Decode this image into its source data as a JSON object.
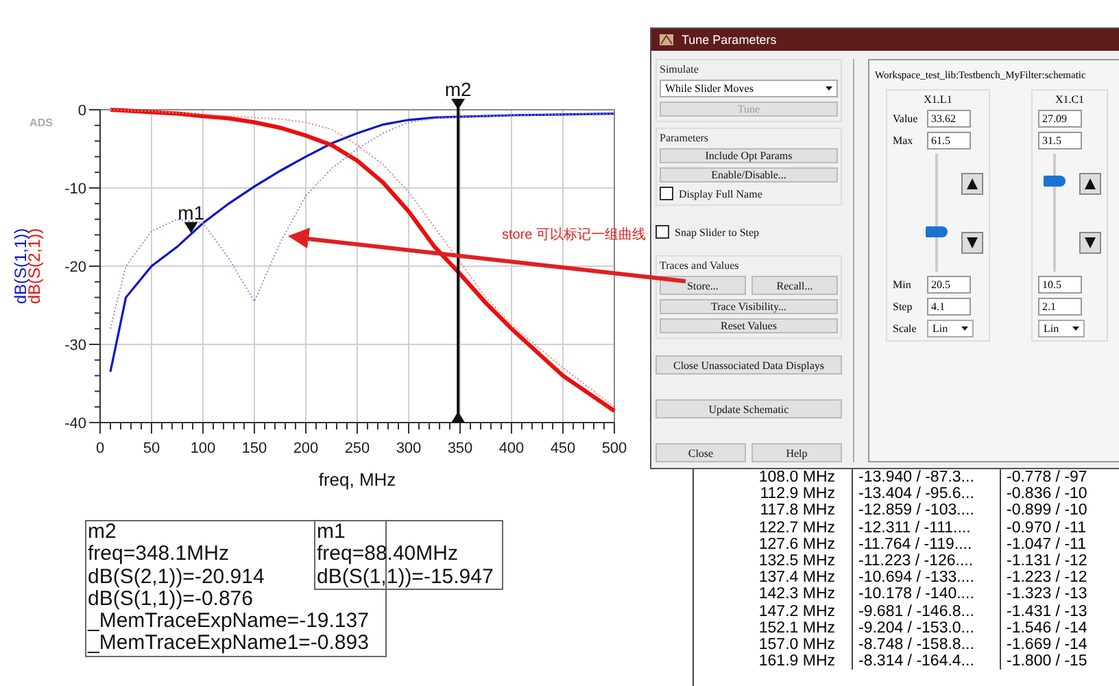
{
  "plot": {
    "logo": "ADS",
    "chart_data": {
      "type": "line",
      "xlabel": "freq, MHz",
      "x": [
        10,
        25,
        50,
        75,
        100,
        125,
        150,
        175,
        200,
        225,
        250,
        275,
        300,
        325,
        350,
        375,
        400,
        450,
        500
      ],
      "series": [
        {
          "name": "dB(S(1,1))",
          "color": "#0a14c8",
          "line_style": "solid",
          "values": [
            -33.5,
            -24,
            -20,
            -17.5,
            -14.5,
            -12,
            -9.8,
            -7.8,
            -6,
            -4.3,
            -3,
            -1.9,
            -1.3,
            -1.0,
            -0.9,
            -0.8,
            -0.7,
            -0.6,
            -0.5
          ]
        },
        {
          "name": "dB(S(2,1))",
          "color": "#e81010",
          "line_style": "solid",
          "values": [
            0,
            -0.1,
            -0.3,
            -0.5,
            -0.8,
            -1.1,
            -1.6,
            -2.3,
            -3.3,
            -4.5,
            -6.5,
            -9.3,
            -13,
            -17.5,
            -21,
            -24.7,
            -28,
            -34,
            -38.5
          ]
        },
        {
          "color": "#8c8ce6",
          "line_style": "dotted",
          "values": [
            -28,
            -20,
            -15.5,
            -14,
            -14.5,
            -19,
            -24.5,
            -17,
            -11,
            -7.5,
            -5,
            -3,
            -1.6,
            -1.1,
            -0.9,
            -0.8,
            -0.7,
            -0.6,
            -0.5
          ]
        },
        {
          "color": "#f08080",
          "line_style": "dotted",
          "values": [
            0,
            -0.1,
            -0.2,
            -0.4,
            -0.6,
            -0.8,
            -1,
            -1.2,
            -1.6,
            -2.5,
            -4.5,
            -7,
            -10.5,
            -15,
            -19.5,
            -24,
            -27.5,
            -33,
            -38
          ]
        }
      ],
      "grid": true,
      "xlim": [
        0,
        500
      ],
      "ylim": [
        -40,
        0
      ],
      "xticks": [
        0,
        50,
        100,
        150,
        200,
        250,
        300,
        350,
        400,
        450,
        500
      ],
      "yticks": [
        0,
        -10,
        -20,
        -30,
        -40
      ],
      "annotations": [
        {
          "text": "m1",
          "x": 88.4,
          "y": -15.947
        }
      ],
      "ref_lines": [
        {
          "axis": "x",
          "value": 348.1,
          "label": "m2",
          "color": "#111111"
        }
      ]
    }
  },
  "marker_readouts": [
    {
      "lines": [
        "m2",
        "freq=348.1MHz",
        "dB(S(2,1))=-20.914",
        "dB(S(1,1))=-0.876",
        "_MemTraceExpName=-19.137",
        "_MemTraceExpName1=-0.893"
      ]
    },
    {
      "lines": [
        "m1",
        "freq=88.40MHz",
        "dB(S(1,1))=-15.947"
      ]
    }
  ],
  "callout": {
    "text": "store 可以标记一组曲线"
  },
  "dialog": {
    "title": "Tune Parameters",
    "simulate": {
      "label": "Simulate",
      "mode": "While Slider Moves",
      "tune": {
        "label": "Tune",
        "disabled": true
      }
    },
    "parameters": {
      "label": "Parameters",
      "buttons": [
        "Include Opt Params",
        "Enable/Disable..."
      ],
      "display_full_name": {
        "label": "Display Full Name",
        "checked": false
      }
    },
    "snap": {
      "label": "Snap Slider to Step",
      "checked": false
    },
    "traces": {
      "label": "Traces and Values",
      "store": "Store...",
      "recall": "Recall...",
      "buttons": [
        "Trace Visibility...",
        "Reset Values"
      ]
    },
    "close_unassociated": "Close Unassociated Data Displays",
    "update": "Update Schematic",
    "close": "Close",
    "help": "Help",
    "schematic": "Workspace_test_lib:Testbench_MyFilter:schematic",
    "field_labels": {
      "value": "Value",
      "max": "Max",
      "min": "Min",
      "step": "Step",
      "scale": "Scale"
    },
    "params": [
      {
        "name": "X1.L1",
        "value": "33.62",
        "max": "61.5",
        "min": "20.5",
        "step": "4.1",
        "scale": "Lin",
        "level": 0.32
      },
      {
        "name": "X1.C1",
        "value": "27.09",
        "max": "31.5",
        "min": "10.5",
        "step": "2.1",
        "scale": "Lin",
        "level": 0.79
      }
    ]
  },
  "data_table": {
    "rows": [
      [
        "108.0 MHz",
        "-13.940 / -87.3...",
        "-0.778 / -97"
      ],
      [
        "112.9 MHz",
        "-13.404 / -95.6...",
        "-0.836 / -10"
      ],
      [
        "117.8 MHz",
        "-12.859 / -103....",
        "-0.899 / -10"
      ],
      [
        "122.7 MHz",
        "-12.311 / -111....",
        "-0.970 / -11"
      ],
      [
        "127.6 MHz",
        "-11.764 / -119....",
        "-1.047 / -11"
      ],
      [
        "132.5 MHz",
        "-11.223 / -126....",
        "-1.131 / -12"
      ],
      [
        "137.4 MHz",
        "-10.694 / -133....",
        "-1.223 / -12"
      ],
      [
        "142.3 MHz",
        "-10.178 / -140....",
        "-1.323 / -13"
      ],
      [
        "147.2 MHz",
        "-9.681 / -146.8...",
        "-1.431 / -13"
      ],
      [
        "152.1 MHz",
        "-9.204 / -153.0...",
        "-1.546 / -14"
      ],
      [
        "157.0 MHz",
        "-8.748 / -158.8...",
        "-1.669 / -14"
      ],
      [
        "161.9 MHz",
        "-8.314 / -164.4...",
        "-1.800 / -15"
      ]
    ]
  }
}
